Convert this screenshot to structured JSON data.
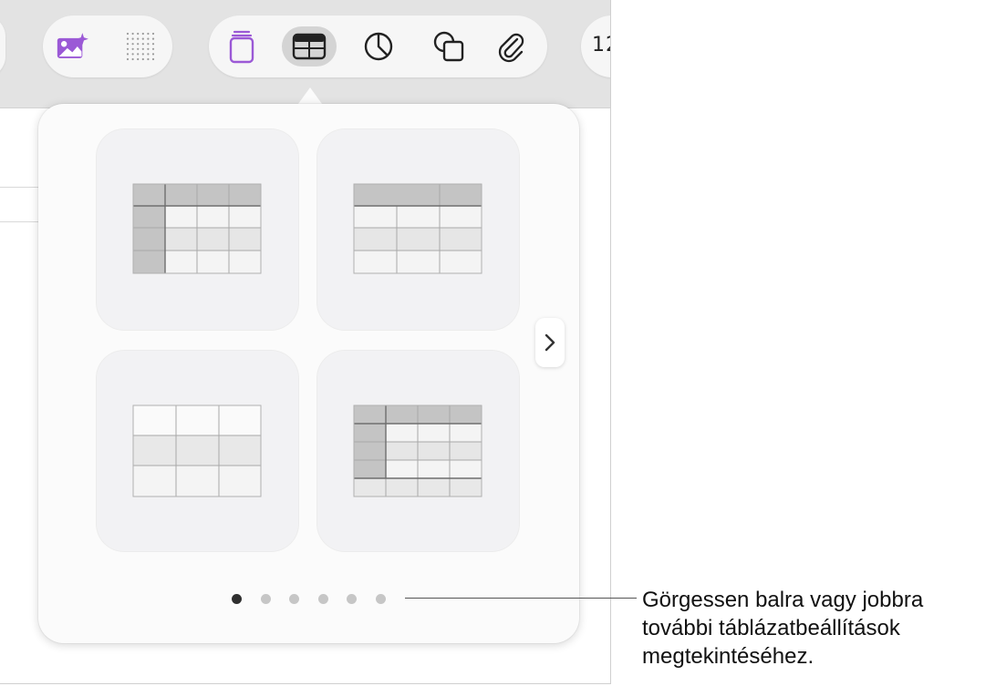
{
  "toolbar": {
    "pages_text_label": "12",
    "icons": {
      "media": "image-sparkle-icon",
      "grid": "dot-grid-icon",
      "text": "text-box-icon",
      "table": "table-icon",
      "chart": "pie-chart-icon",
      "shape": "shape-icon",
      "attachment": "paperclip-icon"
    },
    "accent_color": "#9b59d6",
    "active_button": "table"
  },
  "popover": {
    "tiles": [
      {
        "style": "header-row-and-column"
      },
      {
        "style": "header-row"
      },
      {
        "style": "plain"
      },
      {
        "style": "header-row-column-footer"
      }
    ],
    "next_icon": "chevron-right-icon",
    "page_count": 6,
    "active_page": 1
  },
  "callout": {
    "lines": [
      "Görgessen balra vagy jobbra",
      "további táblázatbeállítások",
      "megtekintéséhez."
    ]
  }
}
